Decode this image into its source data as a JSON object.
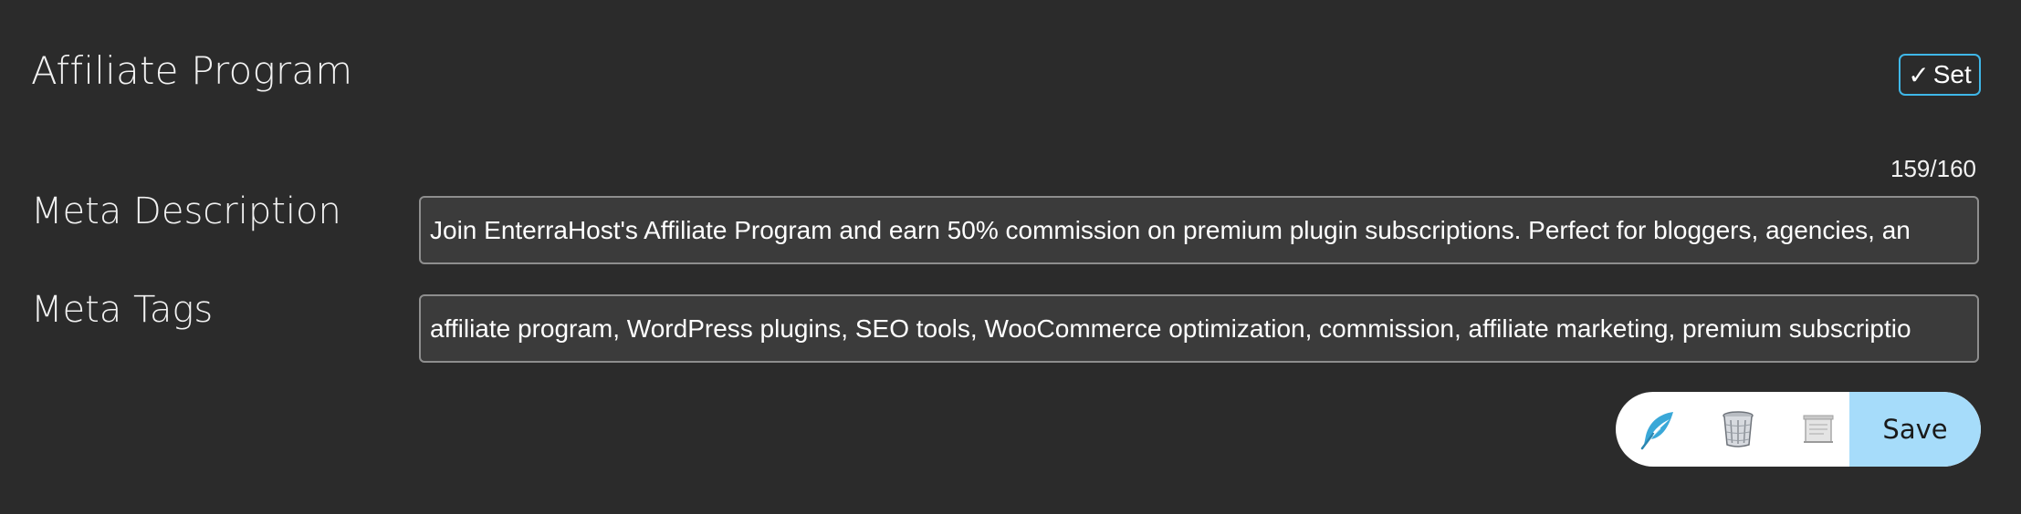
{
  "page": {
    "title": "Affiliate Program"
  },
  "set_button": {
    "check_glyph": "✓",
    "label": "Set",
    "border_color": "#3fb7e8"
  },
  "meta_description": {
    "label": "Meta Description",
    "value": "Join EnterraHost's Affiliate Program and earn 50% commission on premium plugin subscriptions. Perfect for bloggers, agencies, an",
    "counter": "159/160"
  },
  "meta_tags": {
    "label": "Meta Tags",
    "value": "affiliate program, WordPress plugins, SEO tools, WooCommerce optimization, commission, affiliate marketing, premium subscriptio"
  },
  "action_bar": {
    "icons": [
      "feather-icon",
      "trash-icon",
      "document-icon"
    ],
    "save_label": "Save",
    "save_color": "#a6dcfa",
    "feather_color": "#3aa8d8"
  }
}
